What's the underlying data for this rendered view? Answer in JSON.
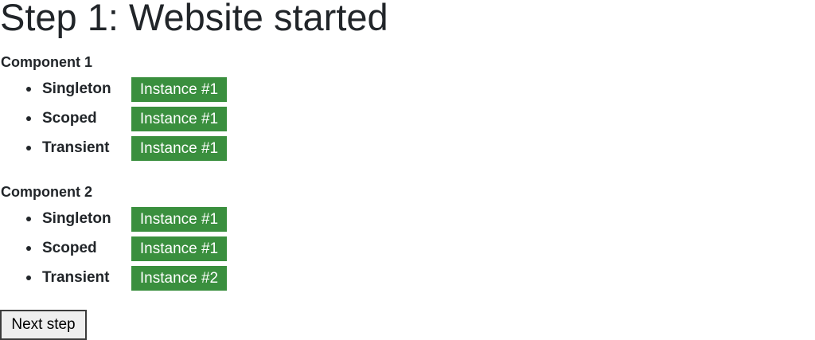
{
  "page": {
    "title": "Step 1: Website started"
  },
  "components": [
    {
      "heading": "Component 1",
      "items": [
        {
          "label": "Singleton",
          "instance": "Instance #1"
        },
        {
          "label": "Scoped",
          "instance": "Instance #1"
        },
        {
          "label": "Transient",
          "instance": "Instance #1"
        }
      ]
    },
    {
      "heading": "Component 2",
      "items": [
        {
          "label": "Singleton",
          "instance": "Instance #1"
        },
        {
          "label": "Scoped",
          "instance": "Instance #1"
        },
        {
          "label": "Transient",
          "instance": "Instance #2"
        }
      ]
    }
  ],
  "actions": {
    "next_label": "Next step"
  },
  "colors": {
    "badge_background": "#3a8f3e",
    "badge_text": "#ffffff",
    "text": "#212529"
  }
}
